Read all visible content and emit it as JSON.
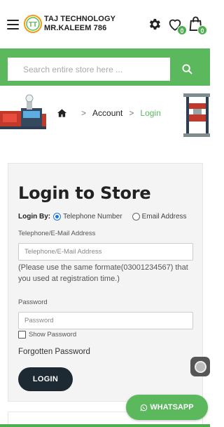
{
  "header": {
    "brand_line1": "TAJ TECHNOLOGY",
    "brand_line2": "MR.KALEEM 786",
    "logo_text": "TT",
    "wishlist_count": "0",
    "cart_count": "0",
    "icons": [
      "menu-icon",
      "logo-icon",
      "gear-icon",
      "heart-icon",
      "cart-icon"
    ]
  },
  "search": {
    "placeholder": "Search entire store here ...",
    "button_icon": "search-icon"
  },
  "breadcrumb": {
    "home_icon": "home-icon",
    "separator": ">",
    "items": [
      "Account",
      "Login"
    ]
  },
  "login": {
    "title": "Login to Store",
    "login_by_label": "Login By:",
    "option_phone": "Telephone Number",
    "option_email": "Email Address",
    "selected_option": "Telephone Number",
    "identifier_label": "Telephone/E-Mail Address",
    "identifier_placeholder": "Telephone/E-Mail Address",
    "note": "(Please use the same formate(03001234567) that you used at registration time.)",
    "password_label": "Password",
    "password_placeholder": "Password",
    "show_password_label": "Show Password",
    "forgot_label": "Forgotten Password",
    "submit_label": "LOGIN"
  },
  "floating": {
    "whatsapp_label": "WHATSAPP"
  },
  "colors": {
    "accent_green": "#5cb85c",
    "badge_green": "#4caf50",
    "dark_button": "#1e2a33",
    "radio_blue": "#1a73e8"
  }
}
